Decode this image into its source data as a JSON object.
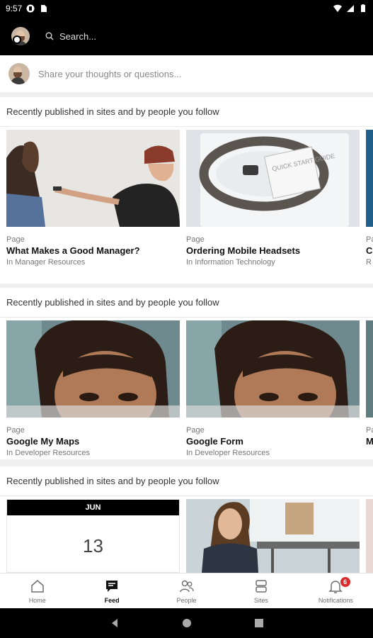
{
  "status_bar": {
    "time": "9:57"
  },
  "search": {
    "placeholder": "Search..."
  },
  "composer": {
    "placeholder": "Share your thoughts or questions..."
  },
  "sections": [
    {
      "heading": "Recently published in sites and by people you follow",
      "cards": [
        {
          "type": "Page",
          "title": "What Makes a Good Manager?",
          "site": "In Manager Resources"
        },
        {
          "type": "Page",
          "title": "Ordering Mobile Headsets",
          "site": "In Information Technology"
        },
        {
          "type": "Pa",
          "title": "C",
          "site": "R"
        }
      ]
    },
    {
      "heading": "Recently published in sites and by people you follow",
      "cards": [
        {
          "type": "Page",
          "title": "Google My Maps",
          "site": "In Developer Resources"
        },
        {
          "type": "Page",
          "title": "Google Form",
          "site": "In Developer Resources"
        },
        {
          "type": "Pa",
          "title": "M",
          "site": ""
        }
      ]
    },
    {
      "heading": "Recently published in sites and by people you follow",
      "calendar": {
        "month": "JUN",
        "day": "13"
      }
    }
  ],
  "headset_box_text": "QUICK START GUIDE",
  "bottom_nav": [
    {
      "label": "Home",
      "icon": "home-icon"
    },
    {
      "label": "Feed",
      "icon": "feed-icon",
      "active": true
    },
    {
      "label": "People",
      "icon": "people-icon"
    },
    {
      "label": "Sites",
      "icon": "sites-icon"
    },
    {
      "label": "Notifications",
      "icon": "bell-icon",
      "badge": "6"
    }
  ]
}
